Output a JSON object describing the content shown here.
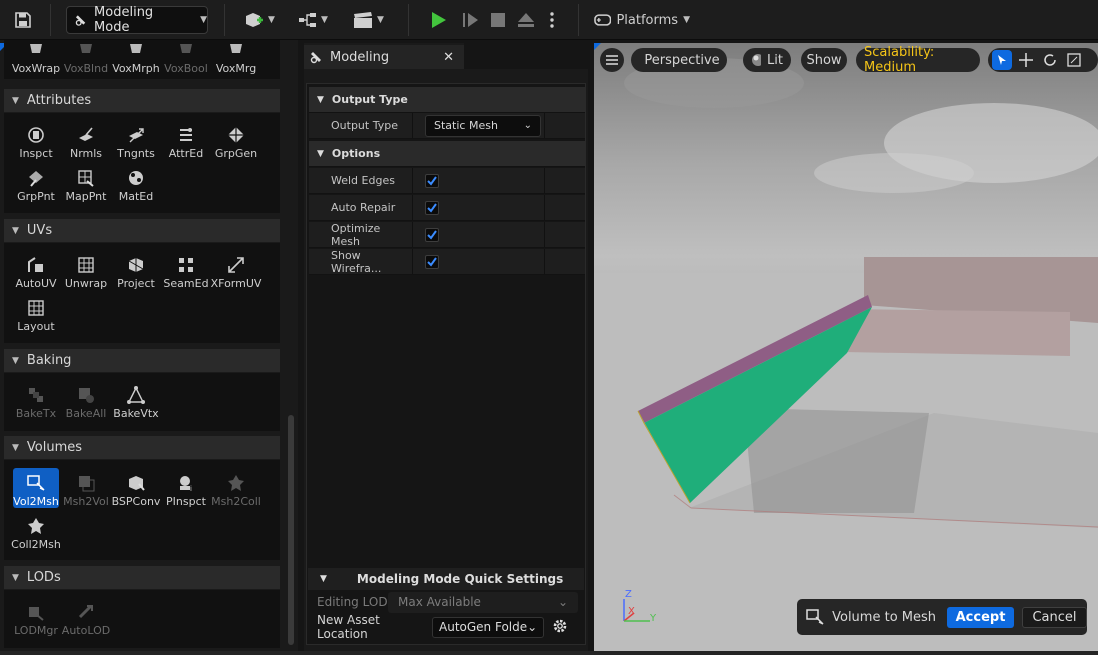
{
  "toolbar": {
    "mode_label": "Modeling Mode",
    "platforms_label": "Platforms"
  },
  "palette": {
    "top_tools": [
      {
        "label": "VoxWrap",
        "enabled": true
      },
      {
        "label": "VoxBlnd",
        "enabled": false
      },
      {
        "label": "VoxMrph",
        "enabled": true
      },
      {
        "label": "VoxBool",
        "enabled": false
      },
      {
        "label": "VoxMrg",
        "enabled": true
      }
    ],
    "attributes": {
      "title": "Attributes",
      "tools": [
        "Inspct",
        "Nrmls",
        "Tngnts",
        "AttrEd",
        "GrpGen",
        "GrpPnt",
        "MapPnt",
        "MatEd"
      ]
    },
    "uvs": {
      "title": "UVs",
      "tools": [
        "AutoUV",
        "Unwrap",
        "Project",
        "SeamEd",
        "XFormUV",
        "Layout"
      ]
    },
    "baking": {
      "title": "Baking",
      "tools": [
        {
          "label": "BakeTx",
          "enabled": false
        },
        {
          "label": "BakeAll",
          "enabled": false
        },
        {
          "label": "BakeVtx",
          "enabled": true
        }
      ]
    },
    "volumes": {
      "title": "Volumes",
      "tools": [
        {
          "label": "Vol2Msh",
          "enabled": true,
          "selected": true
        },
        {
          "label": "Msh2Vol",
          "enabled": false
        },
        {
          "label": "BSPConv",
          "enabled": true
        },
        {
          "label": "PInspct",
          "enabled": true
        },
        {
          "label": "Msh2Coll",
          "enabled": false
        },
        {
          "label": "Coll2Msh",
          "enabled": true
        }
      ]
    },
    "lods": {
      "title": "LODs",
      "tools": [
        {
          "label": "LODMgr",
          "enabled": false
        },
        {
          "label": "AutoLOD",
          "enabled": false
        }
      ]
    }
  },
  "modeling_panel": {
    "tab_label": "Modeling",
    "output_type_category": "Output Type",
    "output_type_label": "Output Type",
    "output_type_value": "Static Mesh",
    "options_category": "Options",
    "options": [
      {
        "label": "Weld Edges",
        "checked": true
      },
      {
        "label": "Auto Repair",
        "checked": true
      },
      {
        "label": "Optimize Mesh",
        "checked": true
      },
      {
        "label": "Show Wirefra...",
        "checked": true
      }
    ],
    "quick_settings": {
      "title": "Modeling Mode Quick Settings",
      "editing_lod_label": "Editing LOD",
      "editing_lod_value": "Max Available",
      "asset_location_label": "New Asset Location",
      "asset_location_value": "AutoGen Folde"
    }
  },
  "viewport": {
    "perspective_label": "Perspective",
    "lit_label": "Lit",
    "show_label": "Show",
    "scalability_label": "Scalability: Medium",
    "scalability_color": "#f5c518",
    "axis_z": "Z",
    "axis_x": "X",
    "axis_y": "Y"
  },
  "toast": {
    "tool_label": "Volume to Mesh",
    "accept_label": "Accept",
    "cancel_label": "Cancel"
  }
}
